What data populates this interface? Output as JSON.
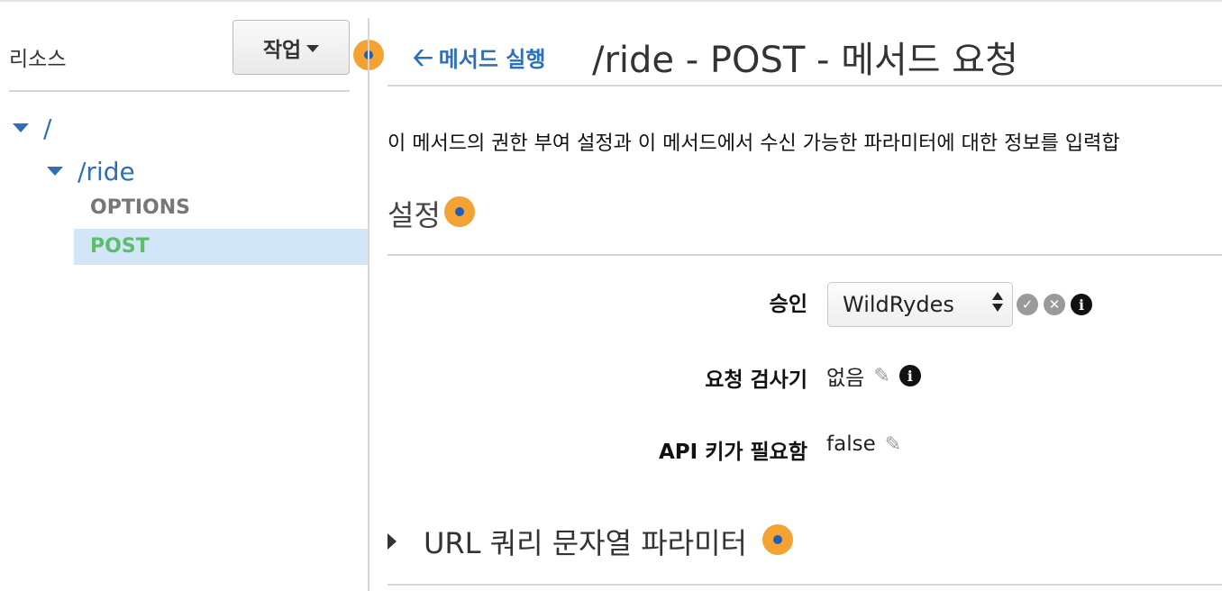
{
  "sidebar": {
    "title": "리소스",
    "actions_label": "작업",
    "tree": {
      "root_label": "/",
      "child_label": "/ride",
      "methods": [
        "OPTIONS",
        "POST"
      ]
    }
  },
  "header": {
    "back_label": "메서드 실행",
    "title": "/ride - POST - 메서드 요청"
  },
  "main": {
    "description": "이 메서드의 권한 부여 설정과 이 메서드에서 수신 가능한 파라미터에 대한 정보를 입력합",
    "settings_title": "설정",
    "fields": {
      "authorization": {
        "label": "승인",
        "value": "WildRydes"
      },
      "validator": {
        "label": "요청 검사기",
        "value": "없음"
      },
      "api_key": {
        "label": "API 키가 필요함",
        "value": "false"
      }
    },
    "query_section_label": "URL 쿼리 문자열 파라미터"
  },
  "colors": {
    "link": "#2f6fb6",
    "help_dot": "#f5a235",
    "selected_bg": "#d3e6f8",
    "post_method": "#5cbd6a"
  },
  "icons": [
    "help-dot-icon",
    "back-arrow-icon",
    "check-icon",
    "cancel-icon",
    "info-icon",
    "pencil-icon",
    "expand-triangle-icon",
    "collapse-triangle-icon"
  ]
}
